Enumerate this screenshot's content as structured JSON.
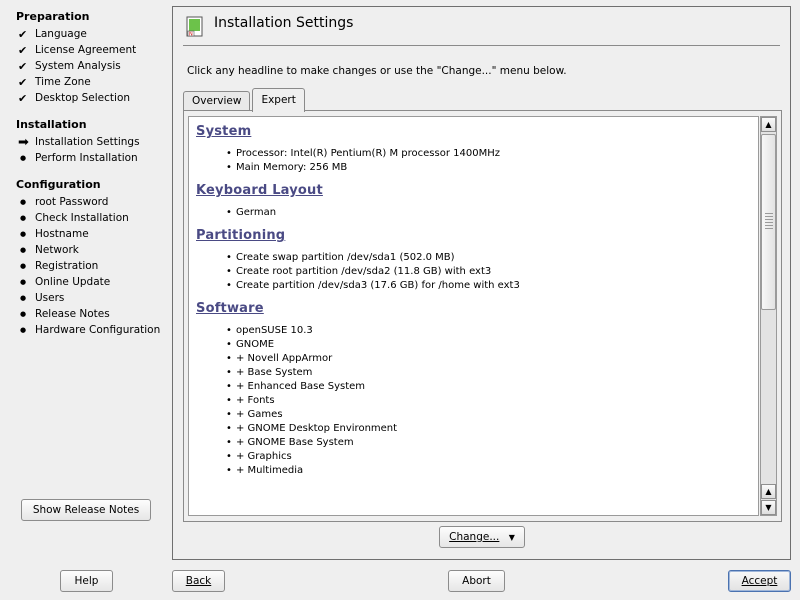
{
  "sidebar": {
    "sections": [
      {
        "title": "Preparation",
        "items": [
          {
            "label": "Language",
            "mark": "check"
          },
          {
            "label": "License Agreement",
            "mark": "check"
          },
          {
            "label": "System Analysis",
            "mark": "check"
          },
          {
            "label": "Time Zone",
            "mark": "check"
          },
          {
            "label": "Desktop Selection",
            "mark": "check"
          }
        ]
      },
      {
        "title": "Installation",
        "items": [
          {
            "label": "Installation Settings",
            "mark": "arrow"
          },
          {
            "label": "Perform Installation",
            "mark": "bullet"
          }
        ]
      },
      {
        "title": "Configuration",
        "items": [
          {
            "label": "root Password",
            "mark": "bullet"
          },
          {
            "label": "Check Installation",
            "mark": "bullet"
          },
          {
            "label": "Hostname",
            "mark": "bullet"
          },
          {
            "label": "Network",
            "mark": "bullet"
          },
          {
            "label": "Registration",
            "mark": "bullet"
          },
          {
            "label": "Online Update",
            "mark": "bullet"
          },
          {
            "label": "Users",
            "mark": "bullet"
          },
          {
            "label": "Release Notes",
            "mark": "bullet"
          },
          {
            "label": "Hardware Configuration",
            "mark": "bullet"
          }
        ]
      }
    ],
    "release_notes_button": "Show Release Notes"
  },
  "main": {
    "title": "Installation Settings",
    "hint": "Click any headline to make changes or use the \"Change...\" menu below.",
    "tabs": [
      {
        "label": "Overview",
        "active": false
      },
      {
        "label": "Expert",
        "active": true
      }
    ],
    "sections": [
      {
        "head": "System",
        "items": [
          "Processor: Intel(R) Pentium(R) M processor 1400MHz",
          "Main Memory: 256 MB"
        ]
      },
      {
        "head": "Keyboard Layout",
        "items": [
          "German"
        ]
      },
      {
        "head": "Partitioning",
        "items": [
          "Create swap partition /dev/sda1 (502.0 MB)",
          "Create root partition /dev/sda2 (11.8 GB) with ext3",
          "Create partition /dev/sda3 (17.6 GB) for /home with ext3"
        ]
      },
      {
        "head": "Software",
        "items": [
          "openSUSE 10.3",
          "GNOME",
          "+ Novell AppArmor",
          "+ Base System",
          "+ Enhanced Base System",
          "+ Fonts",
          "+ Games",
          "+ GNOME Desktop Environment",
          "+ GNOME Base System",
          "+ Graphics",
          "+ Multimedia"
        ]
      }
    ],
    "change_button": "Change...",
    "change_arrow": "▼"
  },
  "footer": {
    "help": "Help",
    "back": "Back",
    "abort": "Abort",
    "accept": "Accept"
  },
  "colors": {
    "section_head": "#4a4a84",
    "accent_border": "#4a72b0"
  },
  "icons": {
    "check": "✔",
    "arrow": "➡",
    "bullet": "●"
  }
}
